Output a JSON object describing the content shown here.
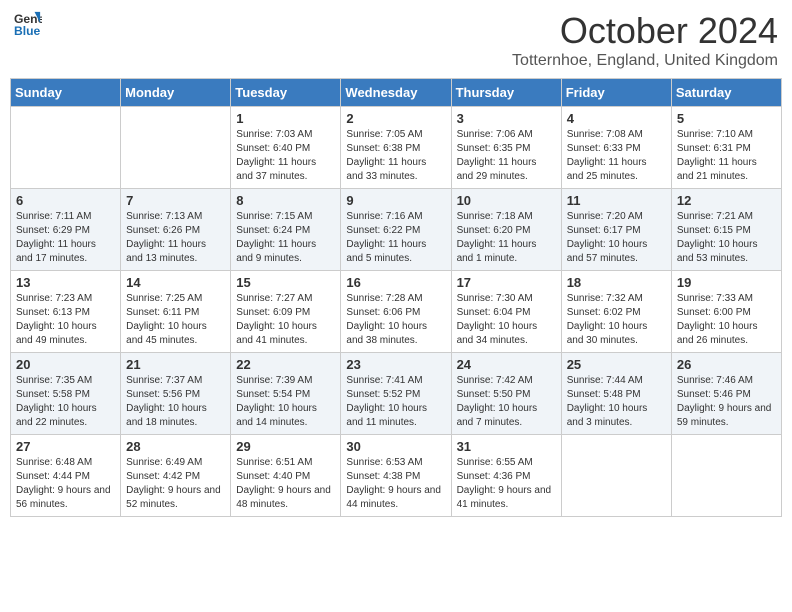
{
  "logo": {
    "line1": "General",
    "line2": "Blue"
  },
  "title": "October 2024",
  "location": "Totternhoe, England, United Kingdom",
  "days_of_week": [
    "Sunday",
    "Monday",
    "Tuesday",
    "Wednesday",
    "Thursday",
    "Friday",
    "Saturday"
  ],
  "weeks": [
    [
      {
        "day": "",
        "info": ""
      },
      {
        "day": "",
        "info": ""
      },
      {
        "day": "1",
        "info": "Sunrise: 7:03 AM\nSunset: 6:40 PM\nDaylight: 11 hours and 37 minutes."
      },
      {
        "day": "2",
        "info": "Sunrise: 7:05 AM\nSunset: 6:38 PM\nDaylight: 11 hours and 33 minutes."
      },
      {
        "day": "3",
        "info": "Sunrise: 7:06 AM\nSunset: 6:35 PM\nDaylight: 11 hours and 29 minutes."
      },
      {
        "day": "4",
        "info": "Sunrise: 7:08 AM\nSunset: 6:33 PM\nDaylight: 11 hours and 25 minutes."
      },
      {
        "day": "5",
        "info": "Sunrise: 7:10 AM\nSunset: 6:31 PM\nDaylight: 11 hours and 21 minutes."
      }
    ],
    [
      {
        "day": "6",
        "info": "Sunrise: 7:11 AM\nSunset: 6:29 PM\nDaylight: 11 hours and 17 minutes."
      },
      {
        "day": "7",
        "info": "Sunrise: 7:13 AM\nSunset: 6:26 PM\nDaylight: 11 hours and 13 minutes."
      },
      {
        "day": "8",
        "info": "Sunrise: 7:15 AM\nSunset: 6:24 PM\nDaylight: 11 hours and 9 minutes."
      },
      {
        "day": "9",
        "info": "Sunrise: 7:16 AM\nSunset: 6:22 PM\nDaylight: 11 hours and 5 minutes."
      },
      {
        "day": "10",
        "info": "Sunrise: 7:18 AM\nSunset: 6:20 PM\nDaylight: 11 hours and 1 minute."
      },
      {
        "day": "11",
        "info": "Sunrise: 7:20 AM\nSunset: 6:17 PM\nDaylight: 10 hours and 57 minutes."
      },
      {
        "day": "12",
        "info": "Sunrise: 7:21 AM\nSunset: 6:15 PM\nDaylight: 10 hours and 53 minutes."
      }
    ],
    [
      {
        "day": "13",
        "info": "Sunrise: 7:23 AM\nSunset: 6:13 PM\nDaylight: 10 hours and 49 minutes."
      },
      {
        "day": "14",
        "info": "Sunrise: 7:25 AM\nSunset: 6:11 PM\nDaylight: 10 hours and 45 minutes."
      },
      {
        "day": "15",
        "info": "Sunrise: 7:27 AM\nSunset: 6:09 PM\nDaylight: 10 hours and 41 minutes."
      },
      {
        "day": "16",
        "info": "Sunrise: 7:28 AM\nSunset: 6:06 PM\nDaylight: 10 hours and 38 minutes."
      },
      {
        "day": "17",
        "info": "Sunrise: 7:30 AM\nSunset: 6:04 PM\nDaylight: 10 hours and 34 minutes."
      },
      {
        "day": "18",
        "info": "Sunrise: 7:32 AM\nSunset: 6:02 PM\nDaylight: 10 hours and 30 minutes."
      },
      {
        "day": "19",
        "info": "Sunrise: 7:33 AM\nSunset: 6:00 PM\nDaylight: 10 hours and 26 minutes."
      }
    ],
    [
      {
        "day": "20",
        "info": "Sunrise: 7:35 AM\nSunset: 5:58 PM\nDaylight: 10 hours and 22 minutes."
      },
      {
        "day": "21",
        "info": "Sunrise: 7:37 AM\nSunset: 5:56 PM\nDaylight: 10 hours and 18 minutes."
      },
      {
        "day": "22",
        "info": "Sunrise: 7:39 AM\nSunset: 5:54 PM\nDaylight: 10 hours and 14 minutes."
      },
      {
        "day": "23",
        "info": "Sunrise: 7:41 AM\nSunset: 5:52 PM\nDaylight: 10 hours and 11 minutes."
      },
      {
        "day": "24",
        "info": "Sunrise: 7:42 AM\nSunset: 5:50 PM\nDaylight: 10 hours and 7 minutes."
      },
      {
        "day": "25",
        "info": "Sunrise: 7:44 AM\nSunset: 5:48 PM\nDaylight: 10 hours and 3 minutes."
      },
      {
        "day": "26",
        "info": "Sunrise: 7:46 AM\nSunset: 5:46 PM\nDaylight: 9 hours and 59 minutes."
      }
    ],
    [
      {
        "day": "27",
        "info": "Sunrise: 6:48 AM\nSunset: 4:44 PM\nDaylight: 9 hours and 56 minutes."
      },
      {
        "day": "28",
        "info": "Sunrise: 6:49 AM\nSunset: 4:42 PM\nDaylight: 9 hours and 52 minutes."
      },
      {
        "day": "29",
        "info": "Sunrise: 6:51 AM\nSunset: 4:40 PM\nDaylight: 9 hours and 48 minutes."
      },
      {
        "day": "30",
        "info": "Sunrise: 6:53 AM\nSunset: 4:38 PM\nDaylight: 9 hours and 44 minutes."
      },
      {
        "day": "31",
        "info": "Sunrise: 6:55 AM\nSunset: 4:36 PM\nDaylight: 9 hours and 41 minutes."
      },
      {
        "day": "",
        "info": ""
      },
      {
        "day": "",
        "info": ""
      }
    ]
  ]
}
